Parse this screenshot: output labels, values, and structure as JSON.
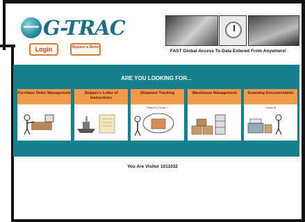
{
  "logo": {
    "text": "G-TRAC"
  },
  "buttons": {
    "login": "Login",
    "request": "Request a Demo"
  },
  "header": {
    "tagline": "FAST Global Access To Data Entered From Anywhere!"
  },
  "panel": {
    "title": "ARE YOU LOOKING FOR...",
    "cards": [
      {
        "title": "Purchase Order Management",
        "sub": ""
      },
      {
        "title": "Shipper's Letter of Instructions",
        "sub": ""
      },
      {
        "title": "Shipment Tracking",
        "sub": "Where Is Order ?"
      },
      {
        "title": "Warehouse Management",
        "sub": ""
      },
      {
        "title": "Scanning Documentation",
        "sub": "Check It!"
      }
    ]
  },
  "footer": {
    "visitor_text": "You Are Visitor 1011032"
  }
}
